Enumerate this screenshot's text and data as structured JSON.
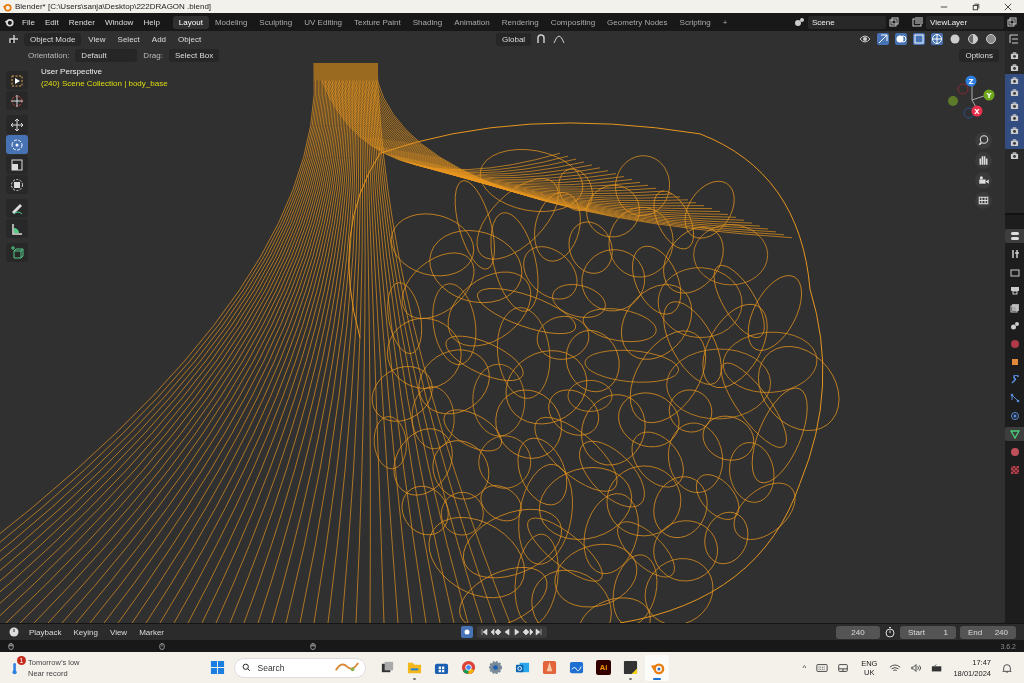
{
  "window": {
    "title": "Blender* [C:\\Users\\sanja\\Desktop\\222DRAGON .blend]"
  },
  "menu": [
    "File",
    "Edit",
    "Render",
    "Window",
    "Help"
  ],
  "workspaces": [
    {
      "label": "Layout",
      "selected": true
    },
    {
      "label": "Modeling",
      "selected": false
    },
    {
      "label": "Sculpting",
      "selected": false
    },
    {
      "label": "UV Editing",
      "selected": false
    },
    {
      "label": "Texture Paint",
      "selected": false
    },
    {
      "label": "Shading",
      "selected": false
    },
    {
      "label": "Animation",
      "selected": false
    },
    {
      "label": "Rendering",
      "selected": false
    },
    {
      "label": "Compositing",
      "selected": false
    },
    {
      "label": "Geometry Nodes",
      "selected": false
    },
    {
      "label": "Scripting",
      "selected": false
    }
  ],
  "add_workspace": "+",
  "scene": {
    "name": "Scene"
  },
  "view_layer": {
    "name": "ViewLayer"
  },
  "header": {
    "mode": "Object Mode",
    "menus": [
      "View",
      "Select",
      "Add",
      "Object"
    ],
    "orientation": "Global"
  },
  "tool_settings": {
    "orientation_label": "Orientation:",
    "orientation": "Default",
    "drag_label": "Drag:",
    "drag": "Select Box",
    "options": "Options"
  },
  "viewport": {
    "view_name": "User Perspective",
    "collection": "(240) Scene Collection | body_base"
  },
  "toolbar": [
    {
      "kind": "select",
      "selected": false
    },
    {
      "kind": "cursor",
      "selected": false
    },
    {
      "kind": "move",
      "selected": false
    },
    {
      "kind": "rotate",
      "selected": true
    },
    {
      "kind": "scale",
      "selected": false
    },
    {
      "kind": "transform",
      "selected": false
    },
    {
      "kind": "annotate",
      "selected": false
    },
    {
      "kind": "measure",
      "selected": false
    },
    {
      "kind": "add",
      "selected": false
    }
  ],
  "axes": [
    {
      "label": "Z",
      "color": "#2f7fe0"
    },
    {
      "label": "Y",
      "color": "#6ea71c"
    },
    {
      "label": "X",
      "color": "#e8304c"
    }
  ],
  "outliner_rows": [
    {
      "selected": false
    },
    {
      "selected": false
    },
    {
      "selected": true
    },
    {
      "selected": true
    },
    {
      "selected": true
    },
    {
      "selected": true
    },
    {
      "selected": true
    },
    {
      "selected": true
    },
    {
      "selected": false
    }
  ],
  "properties_tabs": [
    {
      "kind": "tool",
      "selected": true
    },
    {
      "kind": "render",
      "selected": false
    },
    {
      "kind": "output",
      "selected": false
    },
    {
      "kind": "view",
      "selected": false
    },
    {
      "kind": "scene",
      "selected": false
    },
    {
      "kind": "world",
      "selected": false
    },
    {
      "kind": "object",
      "selected": false
    },
    {
      "kind": "modifier",
      "selected": false
    },
    {
      "kind": "particles",
      "selected": false
    },
    {
      "kind": "physics",
      "selected": false
    },
    {
      "kind": "constraint",
      "selected": false
    },
    {
      "kind": "data",
      "selected": true
    },
    {
      "kind": "material",
      "selected": false
    },
    {
      "kind": "texture",
      "selected": false
    }
  ],
  "timeline": {
    "menus": [
      "Playback",
      "Keying",
      "View",
      "Marker"
    ],
    "current_frame": "240",
    "start_label": "Start",
    "start": "1",
    "end_label": "End",
    "end": "240"
  },
  "status": {
    "version": "3.6.2"
  },
  "taskbar": {
    "weather": {
      "badge": "1",
      "line1": "Tomorrow’s low",
      "line2": "Near record"
    },
    "search_placeholder": "Search",
    "apps": [
      {
        "kind": "taskview",
        "running": false,
        "selected": false
      },
      {
        "kind": "folder",
        "running": true,
        "selected": false
      },
      {
        "kind": "store",
        "running": false,
        "selected": false
      },
      {
        "kind": "browser",
        "running": false,
        "selected": false
      },
      {
        "kind": "settings",
        "running": false,
        "selected": false
      },
      {
        "kind": "mail",
        "running": false,
        "selected": false
      },
      {
        "kind": "sketch",
        "running": false,
        "selected": false
      },
      {
        "kind": "whiteboard",
        "running": false,
        "selected": false
      },
      {
        "kind": "illustrator",
        "running": false,
        "selected": false
      },
      {
        "kind": "notes",
        "running": true,
        "selected": false
      },
      {
        "kind": "blender",
        "running": true,
        "selected": true
      }
    ],
    "illustrator_label": "Ai",
    "tray_chevron": "^",
    "language": "ENG",
    "region": "UK",
    "time": "17:47",
    "date": "18/01/2024"
  }
}
